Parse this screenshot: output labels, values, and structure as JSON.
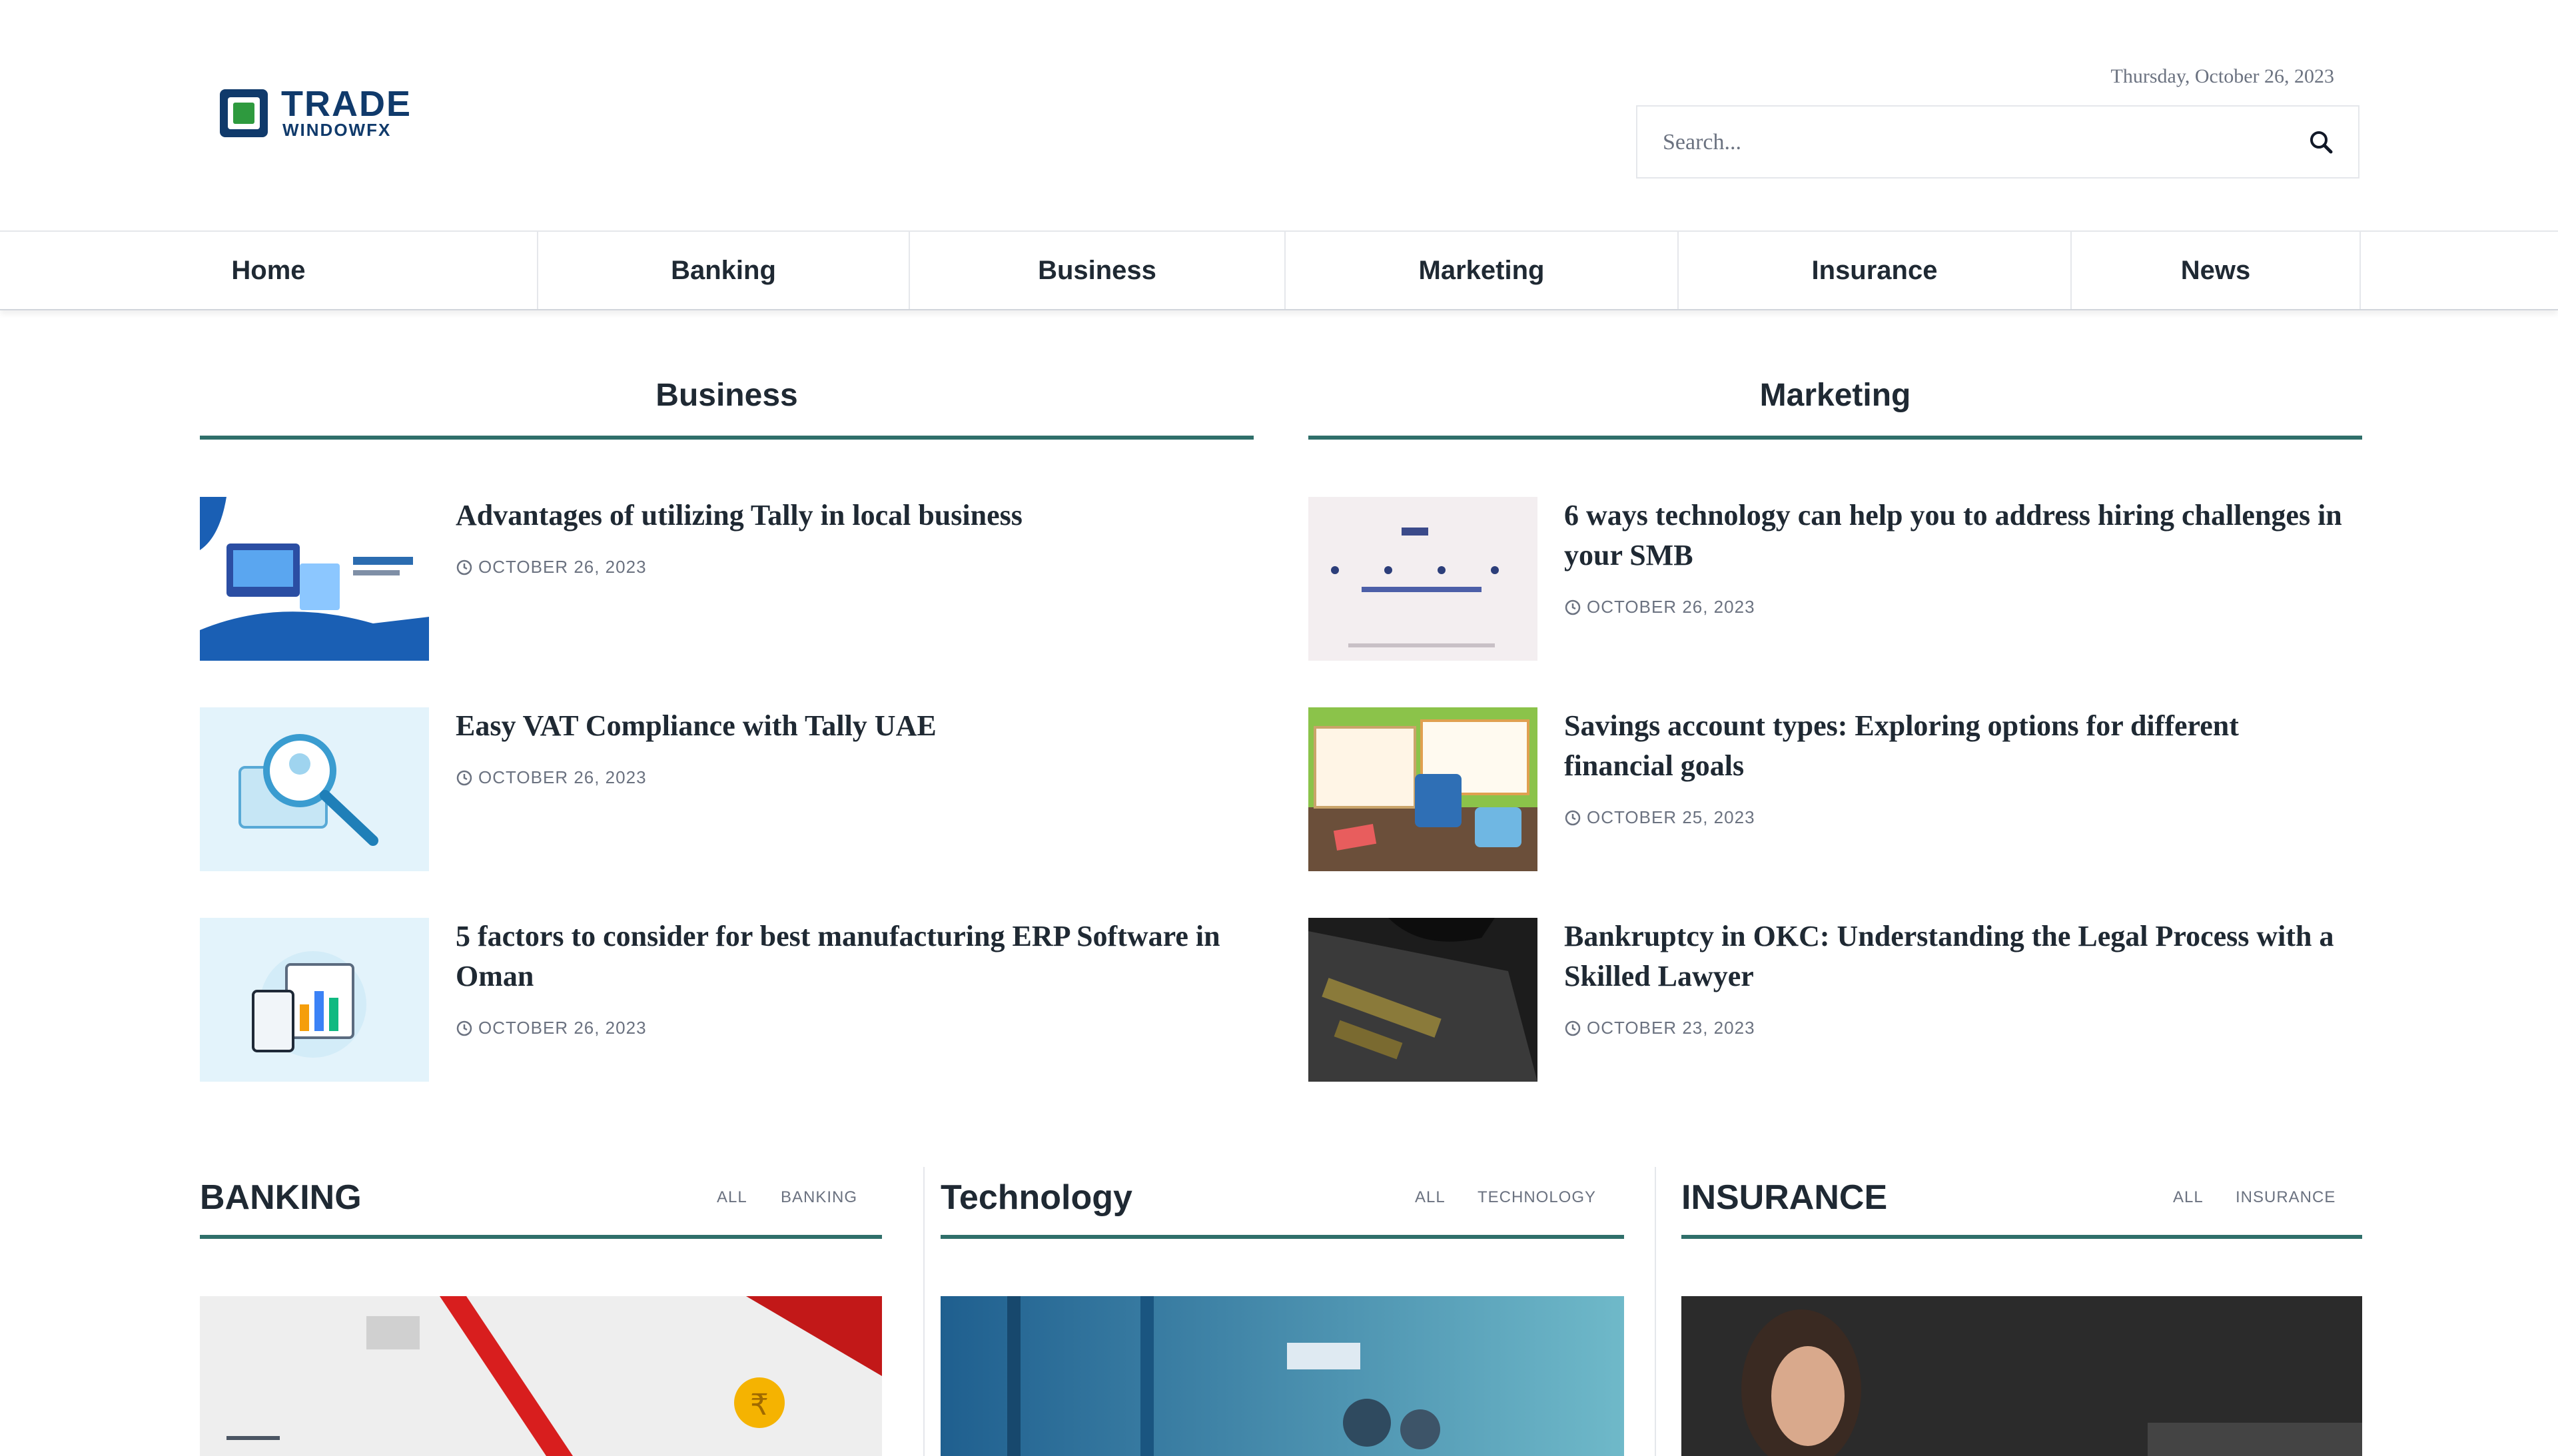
{
  "brand": {
    "name_top": "TRADE",
    "name_bottom": "WINDOWFX",
    "accent": "#2e9a3e",
    "brand_color": "#103a6b"
  },
  "header": {
    "date": "Thursday, October 26, 2023"
  },
  "search": {
    "placeholder": "Search..."
  },
  "nav": {
    "items": [
      "Home",
      "Banking",
      "Business",
      "Marketing",
      "Insurance",
      "News"
    ]
  },
  "sections": {
    "business": {
      "title": "Business",
      "articles": [
        {
          "title": "Advantages of utilizing Tally in local business",
          "date": "OCTOBER 26, 2023"
        },
        {
          "title": "Easy VAT Compliance with Tally UAE",
          "date": "OCTOBER 26, 2023"
        },
        {
          "title": "5 factors to consider for best manufacturing ERP Software in Oman",
          "date": "OCTOBER 26, 2023"
        }
      ]
    },
    "marketing": {
      "title": "Marketing",
      "articles": [
        {
          "title": "6 ways technology can help you to address hiring challenges in your SMB",
          "date": "OCTOBER 26, 2023"
        },
        {
          "title": "Savings account types: Exploring options for different financial goals",
          "date": "OCTOBER 25, 2023"
        },
        {
          "title": "Bankruptcy in OKC: Understanding the Legal Process with a Skilled Lawyer",
          "date": "OCTOBER 23, 2023"
        }
      ]
    }
  },
  "categories": [
    {
      "title": "BANKING",
      "tabs": [
        "ALL",
        "BANKING"
      ]
    },
    {
      "title": "Technology",
      "tabs": [
        "ALL",
        "TECHNOLOGY"
      ]
    },
    {
      "title": "INSURANCE",
      "tabs": [
        "ALL",
        "INSURANCE"
      ]
    }
  ],
  "colors": {
    "section_underline": "#2f6f6a"
  }
}
